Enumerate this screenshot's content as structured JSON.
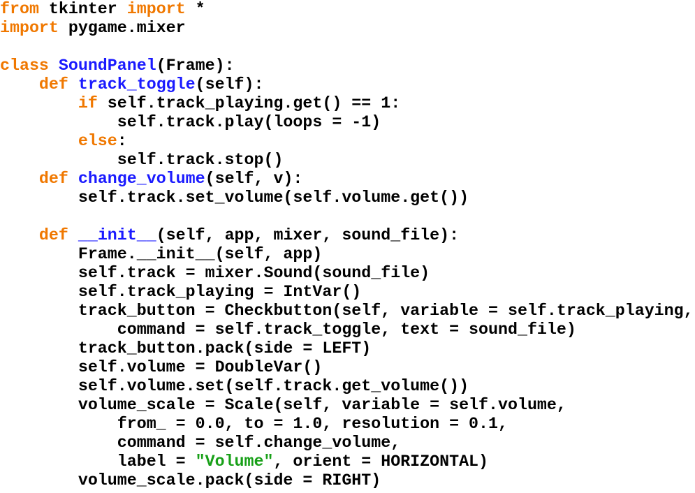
{
  "colors": {
    "keyword": "#f07800",
    "name": "#1a1aff",
    "string": "#18a018",
    "plain": "#000000"
  },
  "code": {
    "lines": [
      [
        {
          "t": "from",
          "k": "keyword"
        },
        {
          "t": " tkinter "
        },
        {
          "t": "import",
          "k": "keyword"
        },
        {
          "t": " *"
        }
      ],
      [
        {
          "t": "import",
          "k": "keyword"
        },
        {
          "t": " pygame.mixer"
        }
      ],
      [],
      [
        {
          "t": "class",
          "k": "keyword"
        },
        {
          "t": " "
        },
        {
          "t": "SoundPanel",
          "k": "name"
        },
        {
          "t": "(Frame):"
        }
      ],
      [
        {
          "t": "    "
        },
        {
          "t": "def",
          "k": "keyword"
        },
        {
          "t": " "
        },
        {
          "t": "track_toggle",
          "k": "name"
        },
        {
          "t": "(self):"
        }
      ],
      [
        {
          "t": "        "
        },
        {
          "t": "if",
          "k": "keyword"
        },
        {
          "t": " self.track_playing.get() == 1:"
        }
      ],
      [
        {
          "t": "            self.track.play(loops = -1)"
        }
      ],
      [
        {
          "t": "        "
        },
        {
          "t": "else",
          "k": "keyword"
        },
        {
          "t": ":"
        }
      ],
      [
        {
          "t": "            self.track.stop()"
        }
      ],
      [
        {
          "t": "    "
        },
        {
          "t": "def",
          "k": "keyword"
        },
        {
          "t": " "
        },
        {
          "t": "change_volume",
          "k": "name"
        },
        {
          "t": "(self, v):"
        }
      ],
      [
        {
          "t": "        self.track.set_volume(self.volume.get())"
        }
      ],
      [],
      [
        {
          "t": "    "
        },
        {
          "t": "def",
          "k": "keyword"
        },
        {
          "t": " "
        },
        {
          "t": "__init__",
          "k": "name"
        },
        {
          "t": "(self, app, mixer, sound_file):"
        }
      ],
      [
        {
          "t": "        Frame.__init__(self, app)"
        }
      ],
      [
        {
          "t": "        self.track = mixer.Sound(sound_file)"
        }
      ],
      [
        {
          "t": "        self.track_playing = IntVar()"
        }
      ],
      [
        {
          "t": "        track_button = Checkbutton(self, variable = self.track_playing,"
        }
      ],
      [
        {
          "t": "            command = self.track_toggle, text = sound_file)"
        }
      ],
      [
        {
          "t": "        track_button.pack(side = LEFT)"
        }
      ],
      [
        {
          "t": "        self.volume = DoubleVar()"
        }
      ],
      [
        {
          "t": "        self.volume.set(self.track.get_volume())"
        }
      ],
      [
        {
          "t": "        volume_scale = Scale(self, variable = self.volume,"
        }
      ],
      [
        {
          "t": "            from_ = 0.0, to = 1.0, resolution = 0.1,"
        }
      ],
      [
        {
          "t": "            command = self.change_volume,"
        }
      ],
      [
        {
          "t": "            label = "
        },
        {
          "t": "\"Volume\"",
          "k": "string"
        },
        {
          "t": ", orient = HORIZONTAL)"
        }
      ],
      [
        {
          "t": "        volume_scale.pack(side = RIGHT)"
        }
      ]
    ]
  }
}
